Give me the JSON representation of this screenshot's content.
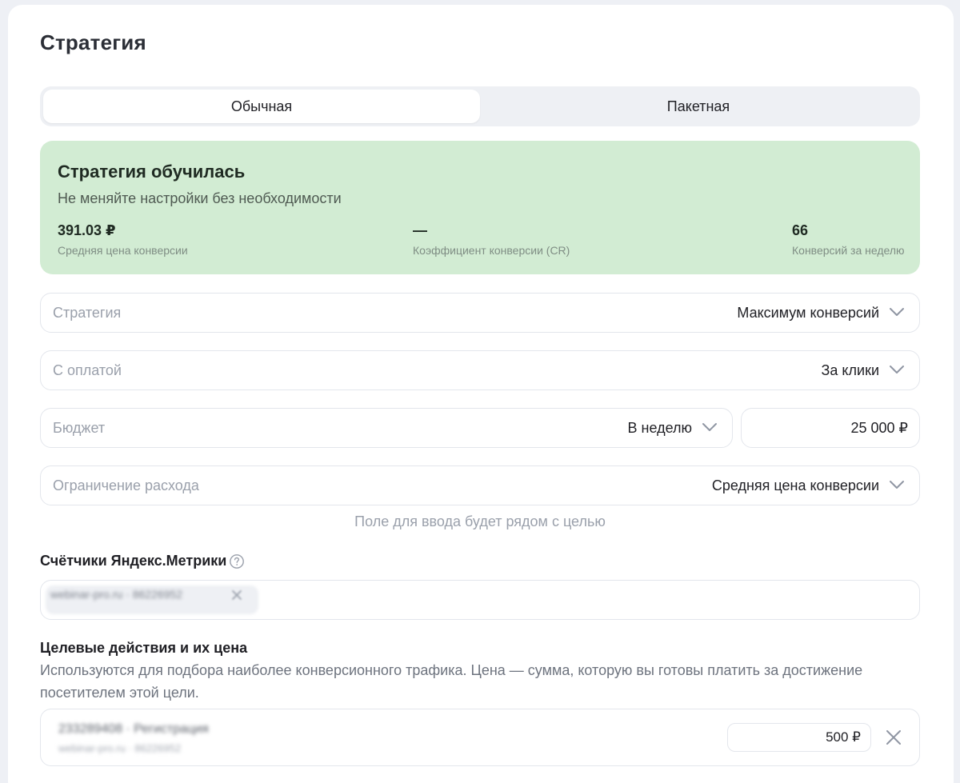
{
  "page": {
    "title": "Стратегия"
  },
  "tabs": [
    {
      "label": "Обычная",
      "active": true
    },
    {
      "label": "Пакетная",
      "active": false
    }
  ],
  "status": {
    "title": "Стратегия обучилась",
    "subtitle": "Не меняйте настройки без необходимости",
    "metrics": [
      {
        "value": "391.03 ₽",
        "label": "Средняя цена конверсии"
      },
      {
        "value": "—",
        "label": "Коэффициент конверсии (CR)"
      },
      {
        "value": "66",
        "label": "Конверсий за неделю"
      }
    ],
    "bg_color": "#d2ecd3"
  },
  "form": {
    "strategy": {
      "label": "Стратегия",
      "value": "Максимум конверсий"
    },
    "payment": {
      "label": "С оплатой",
      "value": "За клики"
    },
    "budget": {
      "label": "Бюджет",
      "period": "В неделю",
      "amount": "25 000 ₽"
    },
    "limit": {
      "label": "Ограничение расхода",
      "value": "Средняя цена конверсии"
    },
    "hint": "Поле для ввода будет рядом с целью"
  },
  "counters": {
    "title": "Счётчики Яндекс.Метрики",
    "help_icon": "question-circle-icon",
    "chip_text": "webinar-pro.ru · 86226952"
  },
  "goals": {
    "title": "Целевые действия и их цена",
    "description": "Используются для подбора наиболее конверсионного трафика. Цена — сумма, которую вы готовы платить за достижение посетителем этой цели.",
    "items": [
      {
        "name": "233289408 · Регистрация",
        "sub": "webinar-pro.ru · 86226952",
        "price": "500 ₽"
      }
    ]
  }
}
